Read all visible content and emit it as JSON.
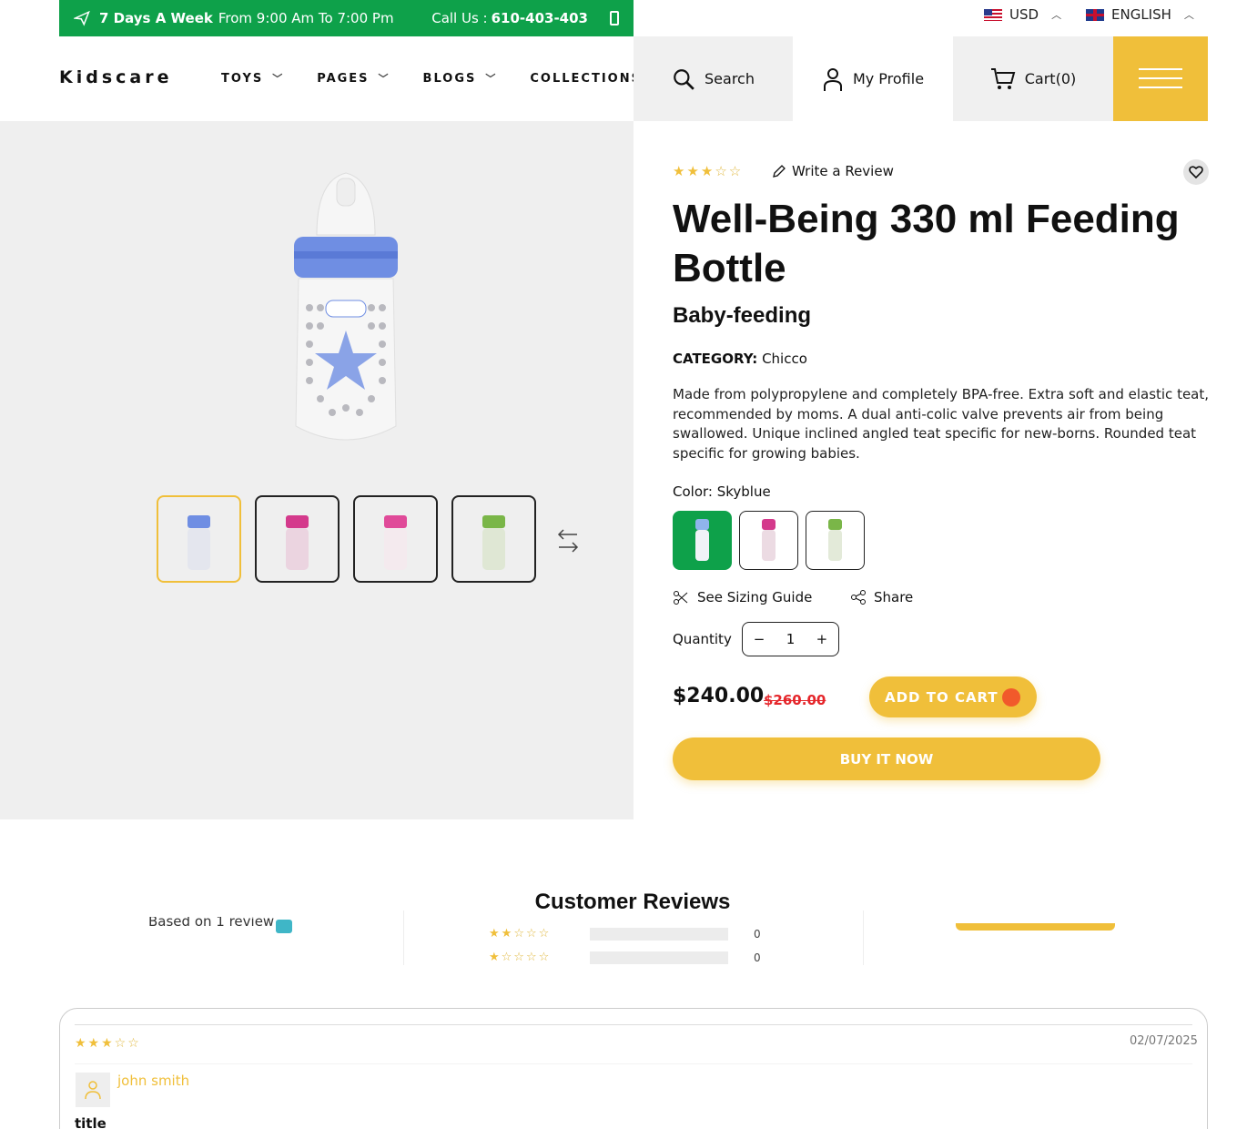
{
  "topbar": {
    "days": "7 Days A Week",
    "hours": "From 9:00 Am To 7:00 Pm",
    "call_prefix": "Call Us :",
    "phone": "610-403-403"
  },
  "locale": {
    "currency": "USD",
    "language": "ENGLISH"
  },
  "header": {
    "logo": "Kidscare",
    "nav": [
      "TOYS",
      "PAGES",
      "BLOGS",
      "COLLECTIONS"
    ],
    "search": "Search",
    "profile": "My Profile",
    "cart": "Cart(0)"
  },
  "product": {
    "rating": 3,
    "write_review": "Write a Review",
    "title": "Well-Being 330 ml Feeding Bottle",
    "subtitle": "Baby-feeding",
    "category_label": "CATEGORY:",
    "category": "Chicco",
    "description": "Made from polypropylene and completely BPA-free. Extra soft and elastic teat, recommended by moms. A dual anti-colic valve prevents air from being swallowed. Unique inclined angled teat specific for new-borns. Rounded teat specific for growing babies.",
    "color_label": "Color: Skyblue",
    "sizing": "See Sizing Guide",
    "share": "Share",
    "quantity_label": "Quantity",
    "quantity": "1",
    "price": "$240.00",
    "old_price": "$260.00",
    "add_to_cart": "ADD TO CART",
    "buy_now": "BUY IT NOW"
  },
  "colors": {
    "green": "#0ea14a",
    "yellow": "#f0bf3a",
    "red": "#e5262b"
  },
  "reviews": {
    "title": "Customer Reviews",
    "based_on": "Based on 1 review",
    "rows": [
      {
        "stars": 2,
        "count": "0"
      },
      {
        "stars": 1,
        "count": "0"
      }
    ],
    "item": {
      "rating": 3,
      "date": "02/07/2025",
      "author": "john smith",
      "title": "title"
    }
  }
}
